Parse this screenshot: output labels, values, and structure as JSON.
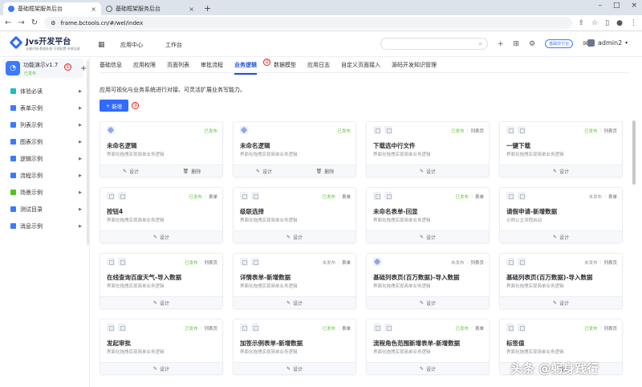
{
  "browser": {
    "tabs": [
      {
        "title": "基础框架服务后台",
        "active": true
      },
      {
        "title": "基础框架服务后台",
        "active": false
      }
    ],
    "url": "frame.bctools.cn/#/wel/index"
  },
  "header": {
    "logo_title": "Jvs开发平台",
    "logo_subtitle": "无缝对接·数据处理·可视配置·系统运维",
    "nav": [
      "应用中心",
      "工作台"
    ],
    "version_badge": "基础交付台",
    "user": "admin2"
  },
  "sidebar": {
    "app_name": "功能演示v1.7",
    "app_status": "已发布",
    "app_marker": "①",
    "items": [
      {
        "label": "体验必读",
        "color": "#13c2c2"
      },
      {
        "label": "表单示例",
        "color": "#3a7afe"
      },
      {
        "label": "列表示例",
        "color": "#3a7afe"
      },
      {
        "label": "图表示例",
        "color": "#3a7afe"
      },
      {
        "label": "逻辑示例",
        "color": "#3a7afe"
      },
      {
        "label": "流程示例",
        "color": "#3a7afe"
      },
      {
        "label": "场景示例",
        "color": "#52c41a"
      },
      {
        "label": "测试目录",
        "color": "#3a7afe"
      },
      {
        "label": "消息示例",
        "color": "#3a7afe"
      }
    ]
  },
  "content": {
    "tabs": [
      "基础信息",
      "应用权限",
      "页面列表",
      "审批流程",
      "业务逻辑",
      "数据模型",
      "应用日志",
      "自定义页面接入",
      "源码开发知识管理"
    ],
    "active_tab_index": 4,
    "tab_marker": "②",
    "description": "应用可视化与业务系统进行对接、可灵活扩展业务写能力。",
    "add_button": "新增",
    "add_marker": "③",
    "cards": [
      {
        "title": "未命名逻辑",
        "desc": "界面化拖拽实现简单业务逻辑",
        "status": "已发布",
        "kind": "",
        "icon": "hex",
        "actions": [
          "设计",
          "删除"
        ]
      },
      {
        "title": "未命名逻辑",
        "desc": "界面化拖拽实现简单业务逻辑",
        "status": "已发布",
        "kind": "",
        "icon": "hex",
        "actions": [
          "设计",
          "删除"
        ]
      },
      {
        "title": "下载选中行文件",
        "desc": "界面化拖拽实现简单业务逻辑",
        "status": "已发布",
        "kind": "列表页",
        "icon": "sq",
        "actions": [
          "设计"
        ]
      },
      {
        "title": "一键下载",
        "desc": "界面化拖拽实现简单业务逻辑",
        "status": "已发布",
        "kind": "列表页",
        "icon": "sq",
        "actions": [
          "设计"
        ]
      },
      {
        "title": "按钮4",
        "desc": "界面化拖拽实现简单业务逻辑",
        "status": "已发布",
        "kind": "表单",
        "icon": "sq",
        "actions": [
          "设计"
        ]
      },
      {
        "title": "级联选择",
        "desc": "界面化拖拽实现简单业务逻辑",
        "status": "已发布",
        "kind": "表单",
        "icon": "sq",
        "actions": [
          "设计"
        ]
      },
      {
        "title": "未命名表单-回显",
        "desc": "界面化拖拽实现简单业务逻辑",
        "status": "已发布",
        "kind": "表单",
        "icon": "sq",
        "actions": [
          "设计"
        ]
      },
      {
        "title": "请假申请-新增数据",
        "desc": "示例公主流程启动",
        "status": "未发布",
        "kind": "表单",
        "icon": "sq",
        "actions": [
          "设计"
        ]
      },
      {
        "title": "在线查询百度天气-导入数据",
        "desc": "界面化拖拽实现简单业务逻辑",
        "status": "已发布",
        "kind": "列表页",
        "icon": "sq",
        "actions": [
          "设计"
        ]
      },
      {
        "title": "详情表单-新增数据",
        "desc": "界面化拖拽实现简单业务逻辑",
        "status": "未发布",
        "kind": "表单",
        "icon": "sq",
        "actions": [
          "设计"
        ]
      },
      {
        "title": "基础列表页(百万数据)-导入数据",
        "desc": "界面化拖拽实现简单业务逻辑",
        "status": "未发布",
        "kind": "列表页",
        "icon": "hex",
        "actions": [
          "设计"
        ]
      },
      {
        "title": "基础列表页(百万数据)-导入数据",
        "desc": "界面化拖拽实现简单业务逻辑",
        "status": "未发布",
        "kind": "列表页",
        "icon": "sq",
        "actions": [
          "设计"
        ]
      },
      {
        "title": "发起审批",
        "desc": "界面化拖拽实现简单业务逻辑",
        "status": "已发布",
        "kind": "列表页",
        "icon": "sq",
        "actions": [
          "设计"
        ]
      },
      {
        "title": "加签示例表单-新增数据",
        "desc": "界面化拖拽实现简单业务逻辑",
        "status": "已发布",
        "kind": "表单",
        "icon": "sq",
        "actions": [
          "设计"
        ]
      },
      {
        "title": "流程角色范围新增表单-新增数据",
        "desc": "界面化拖拽实现简单业务逻辑",
        "status": "已发布",
        "kind": "表单",
        "icon": "sq",
        "actions": [
          "设计"
        ]
      },
      {
        "title": "标签值",
        "desc": "界面化拖拽实现简单业务逻辑",
        "status": "已发布",
        "kind": "列表页",
        "icon": "sq",
        "actions": [
          "设计"
        ]
      }
    ]
  },
  "watermark": "头条 @躬身践行"
}
